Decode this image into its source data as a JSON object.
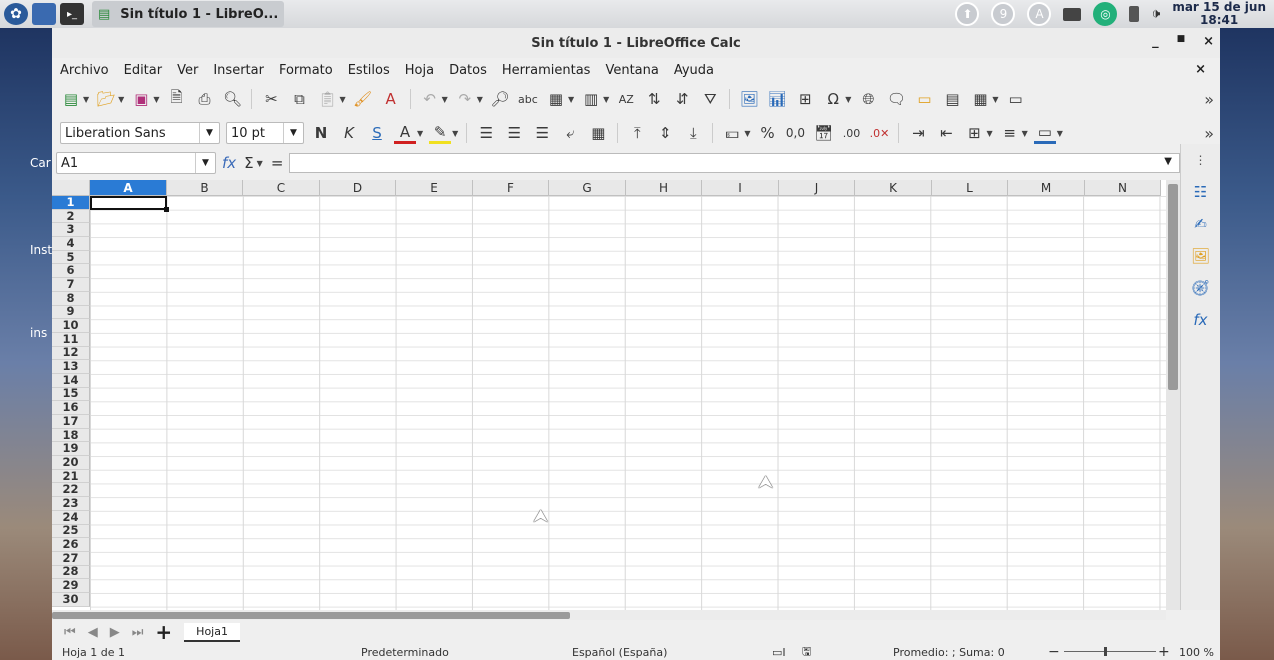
{
  "topbar": {
    "task_title": "Sin título 1 - LibreO...",
    "clock_line1": "mar 15 de jun",
    "clock_line2": "18:41",
    "tray": [
      "upload-icon",
      "9",
      "A",
      "monitor-icon",
      "vpn-icon",
      "battery-icon",
      "volume-icon"
    ]
  },
  "desktop": {
    "labels": [
      "Car",
      "Inst",
      "ins"
    ]
  },
  "window": {
    "title": "Sin título 1 - LibreOffice Calc",
    "controls": [
      "_",
      "■",
      "×"
    ]
  },
  "menu": [
    "Archivo",
    "Editar",
    "Ver",
    "Insertar",
    "Formato",
    "Estilos",
    "Hoja",
    "Datos",
    "Herramientas",
    "Ventana",
    "Ayuda"
  ],
  "font": {
    "name": "Liberation Sans",
    "size": "10 pt"
  },
  "formula": {
    "namebox": "A1",
    "fx": "fx",
    "sum": "Σ",
    "eq": "="
  },
  "columns": [
    "A",
    "B",
    "C",
    "D",
    "E",
    "F",
    "G",
    "H",
    "I",
    "J",
    "K",
    "L",
    "M",
    "N"
  ],
  "rows": [
    "1",
    "2",
    "3",
    "4",
    "5",
    "6",
    "7",
    "8",
    "9",
    "10",
    "11",
    "12",
    "13",
    "14",
    "15",
    "16",
    "17",
    "18",
    "19",
    "20",
    "21",
    "22",
    "23",
    "24",
    "25",
    "26",
    "27",
    "28",
    "29",
    "30"
  ],
  "sheet": {
    "tab": "Hoja1",
    "add": "+"
  },
  "status": {
    "sheet": "Hoja 1 de 1",
    "style": "Predeterminado",
    "lang": "Español (España)",
    "sum": "Promedio: ; Suma: 0",
    "zoom": "100 %"
  }
}
